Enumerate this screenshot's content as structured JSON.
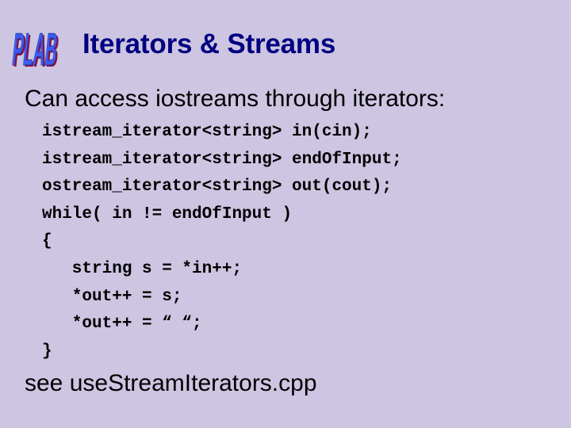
{
  "slide": {
    "logo_text": "PLAB",
    "title": "Iterators & Streams",
    "intro": "Can access iostreams through iterators:",
    "code_lines": [
      "istream_iterator<string> in(cin);",
      "istream_iterator<string> endOfInput;",
      "ostream_iterator<string> out(cout);",
      "while( in != endOfInput )",
      "{",
      "   string s = *in++;",
      "   *out++ = s;",
      "   *out++ = “ “;",
      "}"
    ],
    "footer": "see useStreamIterators.cpp"
  },
  "colors": {
    "background": "#cdc5e1",
    "title": "#000080",
    "logo_fill": "#3a5cf0",
    "logo_shadow": "#8a1040",
    "text": "#000000"
  }
}
